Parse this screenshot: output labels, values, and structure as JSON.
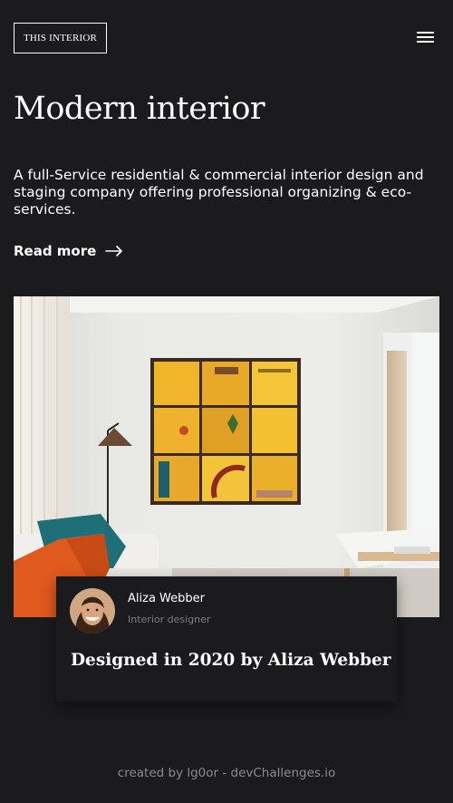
{
  "header": {
    "logo_text": "THIS INTERIOR",
    "menu_icon": "hamburger-menu-icon"
  },
  "hero": {
    "title": "Modern interior",
    "description": "A full-Service residential & commercial interior design and staging company offering professional organizing & eco-services.",
    "read_more_label": "Read more",
    "read_more_icon": "arrow-right-icon",
    "image_alt": "Living room with a yellow grid wall art, floor lamp and sofa with orange and teal cushions"
  },
  "designer_card": {
    "name": "Aliza Webber",
    "role": "Interior designer",
    "headline": "Designed in 2020 by Aliza Webber"
  },
  "footer": {
    "credit": "created by lg0or - devChallenges.io"
  },
  "colors": {
    "background": "#1b1b1d",
    "text": "#ffffff",
    "muted": "#7f7f85",
    "art_yellow": "#f2c031"
  }
}
